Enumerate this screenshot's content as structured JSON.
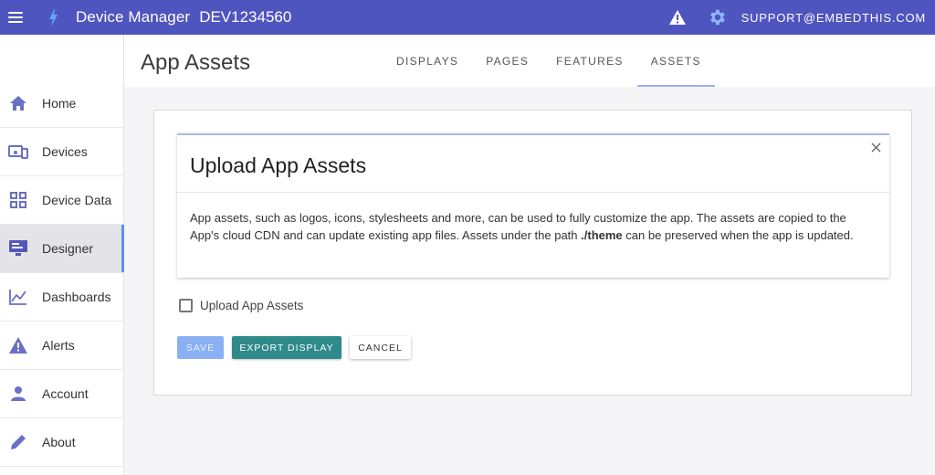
{
  "topbar": {
    "app_title": "Device Manager",
    "device_id": "DEV1234560",
    "support_email": "SUPPORT@EMBEDTHIS.COM",
    "icons": [
      "menu-icon",
      "bolt-logo-icon",
      "warning-icon",
      "gear-icon"
    ],
    "colors": {
      "bar": "#4f55be",
      "text": "#ffffff"
    }
  },
  "sidebar": {
    "items": [
      {
        "label": "Home",
        "icon": "home-icon"
      },
      {
        "label": "Devices",
        "icon": "devices-icon"
      },
      {
        "label": "Device Data",
        "icon": "grid-icon"
      },
      {
        "label": "Designer",
        "icon": "designer-monitor-icon",
        "active": true
      },
      {
        "label": "Dashboards",
        "icon": "chart-line-icon"
      },
      {
        "label": "Alerts",
        "icon": "alert-icon"
      },
      {
        "label": "Account",
        "icon": "person-icon"
      },
      {
        "label": "About",
        "icon": "pencil-icon"
      }
    ],
    "colors": {
      "icon": "#6b70c4",
      "active_bg": "#e4e4e8",
      "active_indicator": "#5e8ef7"
    }
  },
  "header": {
    "page_title": "App Assets",
    "tabs": [
      {
        "label": "DISPLAYS"
      },
      {
        "label": "PAGES"
      },
      {
        "label": "FEATURES"
      },
      {
        "label": "ASSETS",
        "active": true
      }
    ]
  },
  "dialog": {
    "title": "Upload App Assets",
    "body_pre": "App assets, such as logos, icons, stylesheets and more, can be used to fully customize the app. The assets are copied to the App's cloud CDN and can update existing app files. Assets under the path ",
    "body_bold": "./theme",
    "body_post": " can be preserved when the app is updated."
  },
  "form": {
    "checkbox_label": "Upload App Assets",
    "checkbox_checked": false,
    "save_label": "SAVE",
    "export_label": "EXPORT DISPLAY",
    "cancel_label": "CANCEL",
    "colors": {
      "save": "#8ab0f4",
      "export": "#2f8a8a"
    }
  }
}
